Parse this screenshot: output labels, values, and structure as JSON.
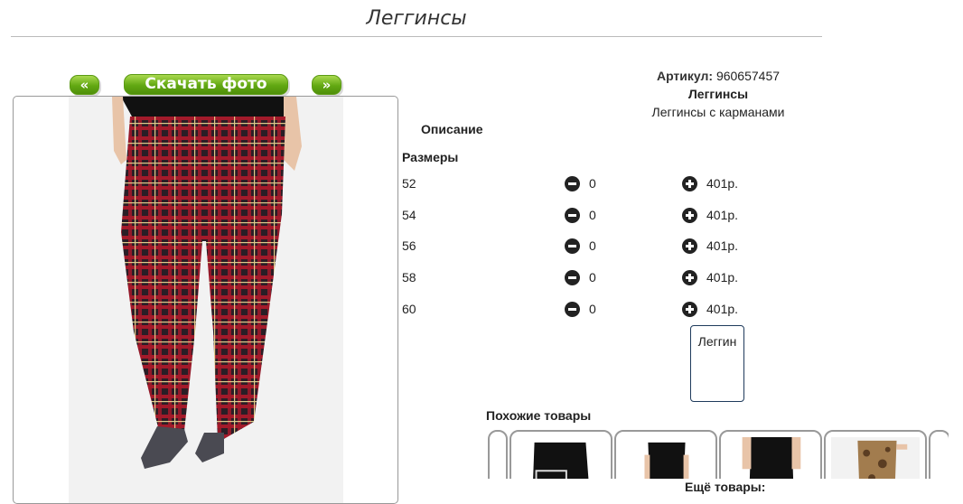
{
  "page": {
    "title": "Леггинсы"
  },
  "gallery": {
    "prev_label": "«",
    "download_label": "Скачать фото",
    "next_label": "»"
  },
  "product": {
    "sku_label": "Артикул:",
    "sku_value": "960657457",
    "name": "Леггинсы",
    "short_description": "Леггинсы с карманами",
    "description_label": "Описание",
    "sizes_label": "Размеры"
  },
  "sizes": [
    {
      "size": "52",
      "qty": "0",
      "price": "401р."
    },
    {
      "size": "54",
      "qty": "0",
      "price": "401р."
    },
    {
      "size": "56",
      "qty": "0",
      "price": "401р."
    },
    {
      "size": "58",
      "qty": "0",
      "price": "401р."
    },
    {
      "size": "60",
      "qty": "0",
      "price": "401р."
    }
  ],
  "color_option": {
    "label": "Леггин"
  },
  "similar": {
    "title": "Похожие товары"
  },
  "more": {
    "title": "Ещё товары:"
  },
  "icons": {
    "decrease": "minus-circle-icon",
    "increase": "plus-circle-icon"
  },
  "colors": {
    "button_green": "#62a812",
    "swatch_border": "#1f3b5c"
  }
}
